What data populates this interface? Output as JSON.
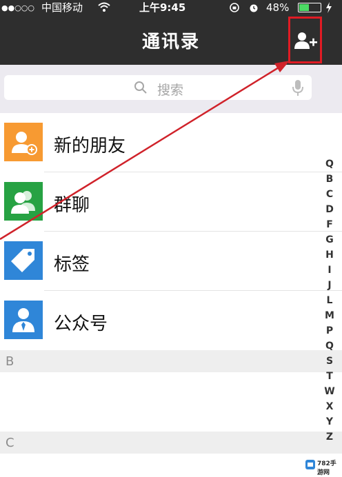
{
  "status_bar": {
    "signal": "●●○○○",
    "carrier": "中国移动",
    "time": "上午9:45",
    "battery": "48%",
    "battery_level": 0.48,
    "icons": [
      "wifi-icon",
      "rotation-lock-icon",
      "alarm-icon",
      "battery-icon",
      "charging-icon"
    ]
  },
  "header": {
    "title": "通讯录",
    "add_contact_icon": "add-contact-icon",
    "highlight_color": "#e01b24"
  },
  "search": {
    "placeholder": "搜索",
    "icons": [
      "search-icon",
      "microphone-icon"
    ]
  },
  "contacts_menu": [
    {
      "label": "新的朋友",
      "icon": "new-friends-icon",
      "color": "#f79a32"
    },
    {
      "label": "群聊",
      "icon": "group-chat-icon",
      "color": "#27a243"
    },
    {
      "label": "标签",
      "icon": "tag-icon",
      "color": "#2f86d8"
    },
    {
      "label": "公众号",
      "icon": "official-account-icon",
      "color": "#2f86d8"
    }
  ],
  "sections": [
    {
      "letter": "B"
    },
    {
      "letter": "C"
    }
  ],
  "index_bar": [
    "Q",
    "B",
    "C",
    "D",
    "F",
    "G",
    "H",
    "I",
    "J",
    "L",
    "M",
    "P",
    "Q",
    "S",
    "T",
    "W",
    "X",
    "Y",
    "Z"
  ],
  "watermark": {
    "text": "782手游网"
  },
  "colors": {
    "nav_bg": "#2e2e2e",
    "annotation_red": "#d0222a",
    "section_bg": "#eeeeee"
  }
}
